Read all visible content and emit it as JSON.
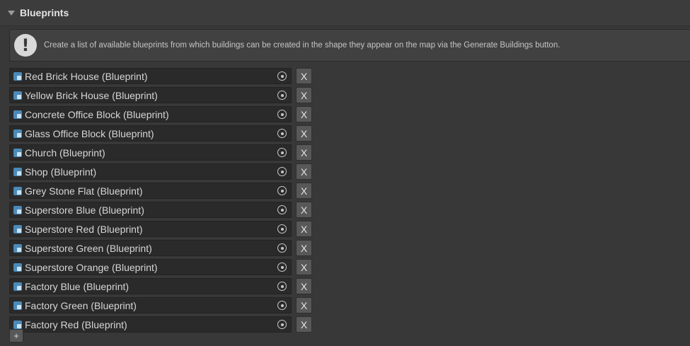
{
  "section": {
    "title": "Blueprints"
  },
  "help": {
    "icon": "warning-exclamation-icon",
    "text": "Create a list of available blueprints from which buildings can be created in the shape they appear on the map via the Generate Buildings button."
  },
  "list": {
    "remove_label": "X",
    "add_label": "+",
    "items": [
      "Red Brick House (Blueprint)",
      "Yellow Brick House (Blueprint)",
      "Concrete Office Block (Blueprint)",
      "Glass Office Block (Blueprint)",
      "Church (Blueprint)",
      "Shop (Blueprint)",
      "Grey Stone Flat (Blueprint)",
      "Superstore Blue (Blueprint)",
      "Superstore Red (Blueprint)",
      "Superstore Green (Blueprint)",
      "Superstore Orange (Blueprint)",
      "Factory Blue (Blueprint)",
      "Factory Green (Blueprint)",
      "Factory Red (Blueprint)"
    ]
  },
  "colors": {
    "background": "#383838",
    "field": "#2a2a2a",
    "button": "#585858",
    "asset_icon": "#4b8ab8"
  }
}
